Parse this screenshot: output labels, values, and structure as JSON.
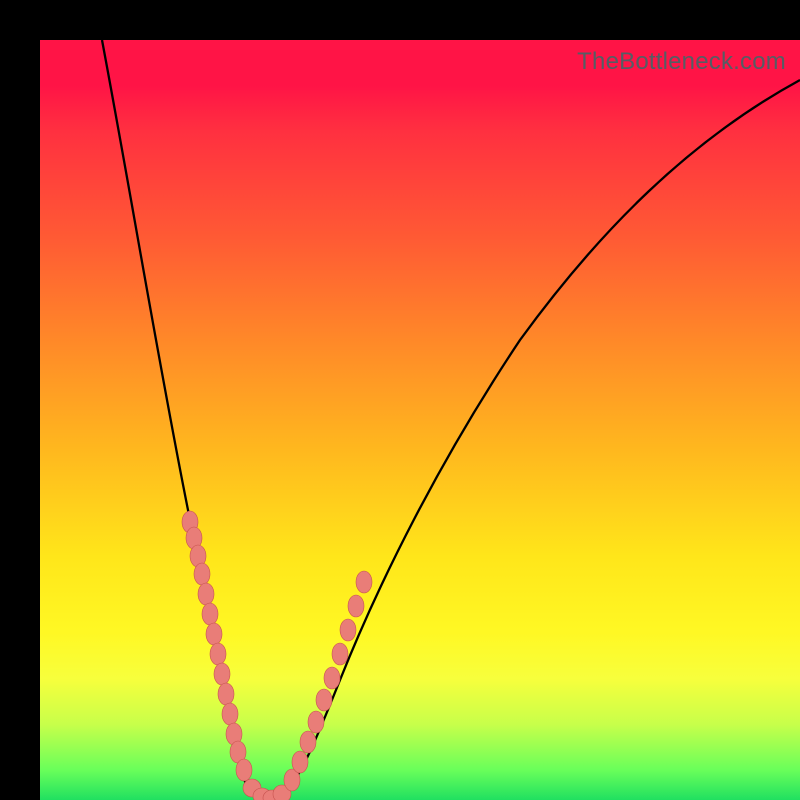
{
  "watermark": "TheBottleneck.com",
  "colors": {
    "frame": "#000000",
    "curve": "#000000",
    "dot_fill": "#e97d78",
    "dot_stroke": "#c8534f"
  },
  "chart_data": {
    "type": "line",
    "title": "",
    "xlabel": "",
    "ylabel": "",
    "xlim": [
      0,
      100
    ],
    "ylim": [
      0,
      100
    ],
    "grid": false,
    "legend": "none",
    "notes": "Axes are unlabeled; values estimated from curve geometry. x ≈ component balance parameter, y ≈ bottleneck percentage (0 = optimal, 100 = worst).",
    "series": [
      {
        "name": "bottleneck-curve",
        "x": [
          0,
          4,
          8,
          12,
          16,
          18,
          20,
          22,
          24,
          25,
          26,
          28,
          30,
          34,
          38,
          44,
          52,
          62,
          74,
          88,
          100
        ],
        "values": [
          100,
          85,
          70,
          55,
          41,
          33,
          25,
          16,
          8,
          4,
          2,
          0,
          2,
          7,
          14,
          24,
          36,
          49,
          62,
          74,
          84
        ]
      }
    ],
    "datapoints_overlay": {
      "name": "sample-dots",
      "note": "Pink scatter points clustered along the V near the minimum.",
      "points": [
        {
          "x": 17,
          "y": 37
        },
        {
          "x": 18,
          "y": 34
        },
        {
          "x": 18.5,
          "y": 31
        },
        {
          "x": 19,
          "y": 28
        },
        {
          "x": 20,
          "y": 24
        },
        {
          "x": 20.5,
          "y": 21
        },
        {
          "x": 21,
          "y": 18
        },
        {
          "x": 21.5,
          "y": 16
        },
        {
          "x": 22,
          "y": 14
        },
        {
          "x": 22.5,
          "y": 11
        },
        {
          "x": 23,
          "y": 9
        },
        {
          "x": 23.5,
          "y": 7
        },
        {
          "x": 24,
          "y": 5
        },
        {
          "x": 25,
          "y": 2
        },
        {
          "x": 26,
          "y": 1
        },
        {
          "x": 27,
          "y": 0
        },
        {
          "x": 28,
          "y": 0
        },
        {
          "x": 29,
          "y": 1
        },
        {
          "x": 30,
          "y": 3
        },
        {
          "x": 31,
          "y": 5
        },
        {
          "x": 32,
          "y": 8
        },
        {
          "x": 33,
          "y": 11
        },
        {
          "x": 34,
          "y": 14
        },
        {
          "x": 35,
          "y": 17
        },
        {
          "x": 36,
          "y": 20
        },
        {
          "x": 37,
          "y": 23
        },
        {
          "x": 38,
          "y": 26
        },
        {
          "x": 39,
          "y": 29
        }
      ]
    }
  }
}
